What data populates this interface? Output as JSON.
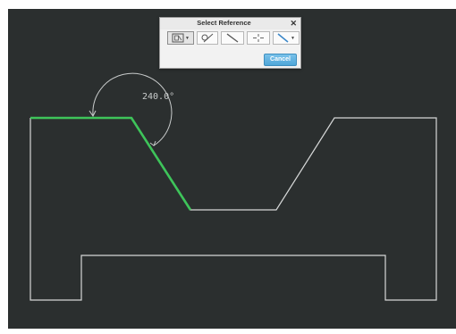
{
  "dialog": {
    "title": "Select Reference",
    "close_icon": "close-icon",
    "cancel_label": "Cancel",
    "tools": [
      {
        "name": "select-entity-tool",
        "icon": "select-box-icon",
        "has_dropdown": true
      },
      {
        "name": "select-curve-tool",
        "icon": "curve-icon",
        "has_dropdown": false
      },
      {
        "name": "select-edge-tool",
        "icon": "line-icon",
        "has_dropdown": false
      },
      {
        "name": "select-point-tool",
        "icon": "point-icon",
        "has_dropdown": false
      },
      {
        "name": "select-axis-tool",
        "icon": "axis-line-icon",
        "has_dropdown": true
      }
    ]
  },
  "sketch": {
    "angle_dimension": "240.0°",
    "colors": {
      "background": "#2b2f2f",
      "outline": "#d6d8d8",
      "highlight": "#3ec45a",
      "dimension": "#c9cccc",
      "button_accent": "#4fa6d8"
    }
  }
}
